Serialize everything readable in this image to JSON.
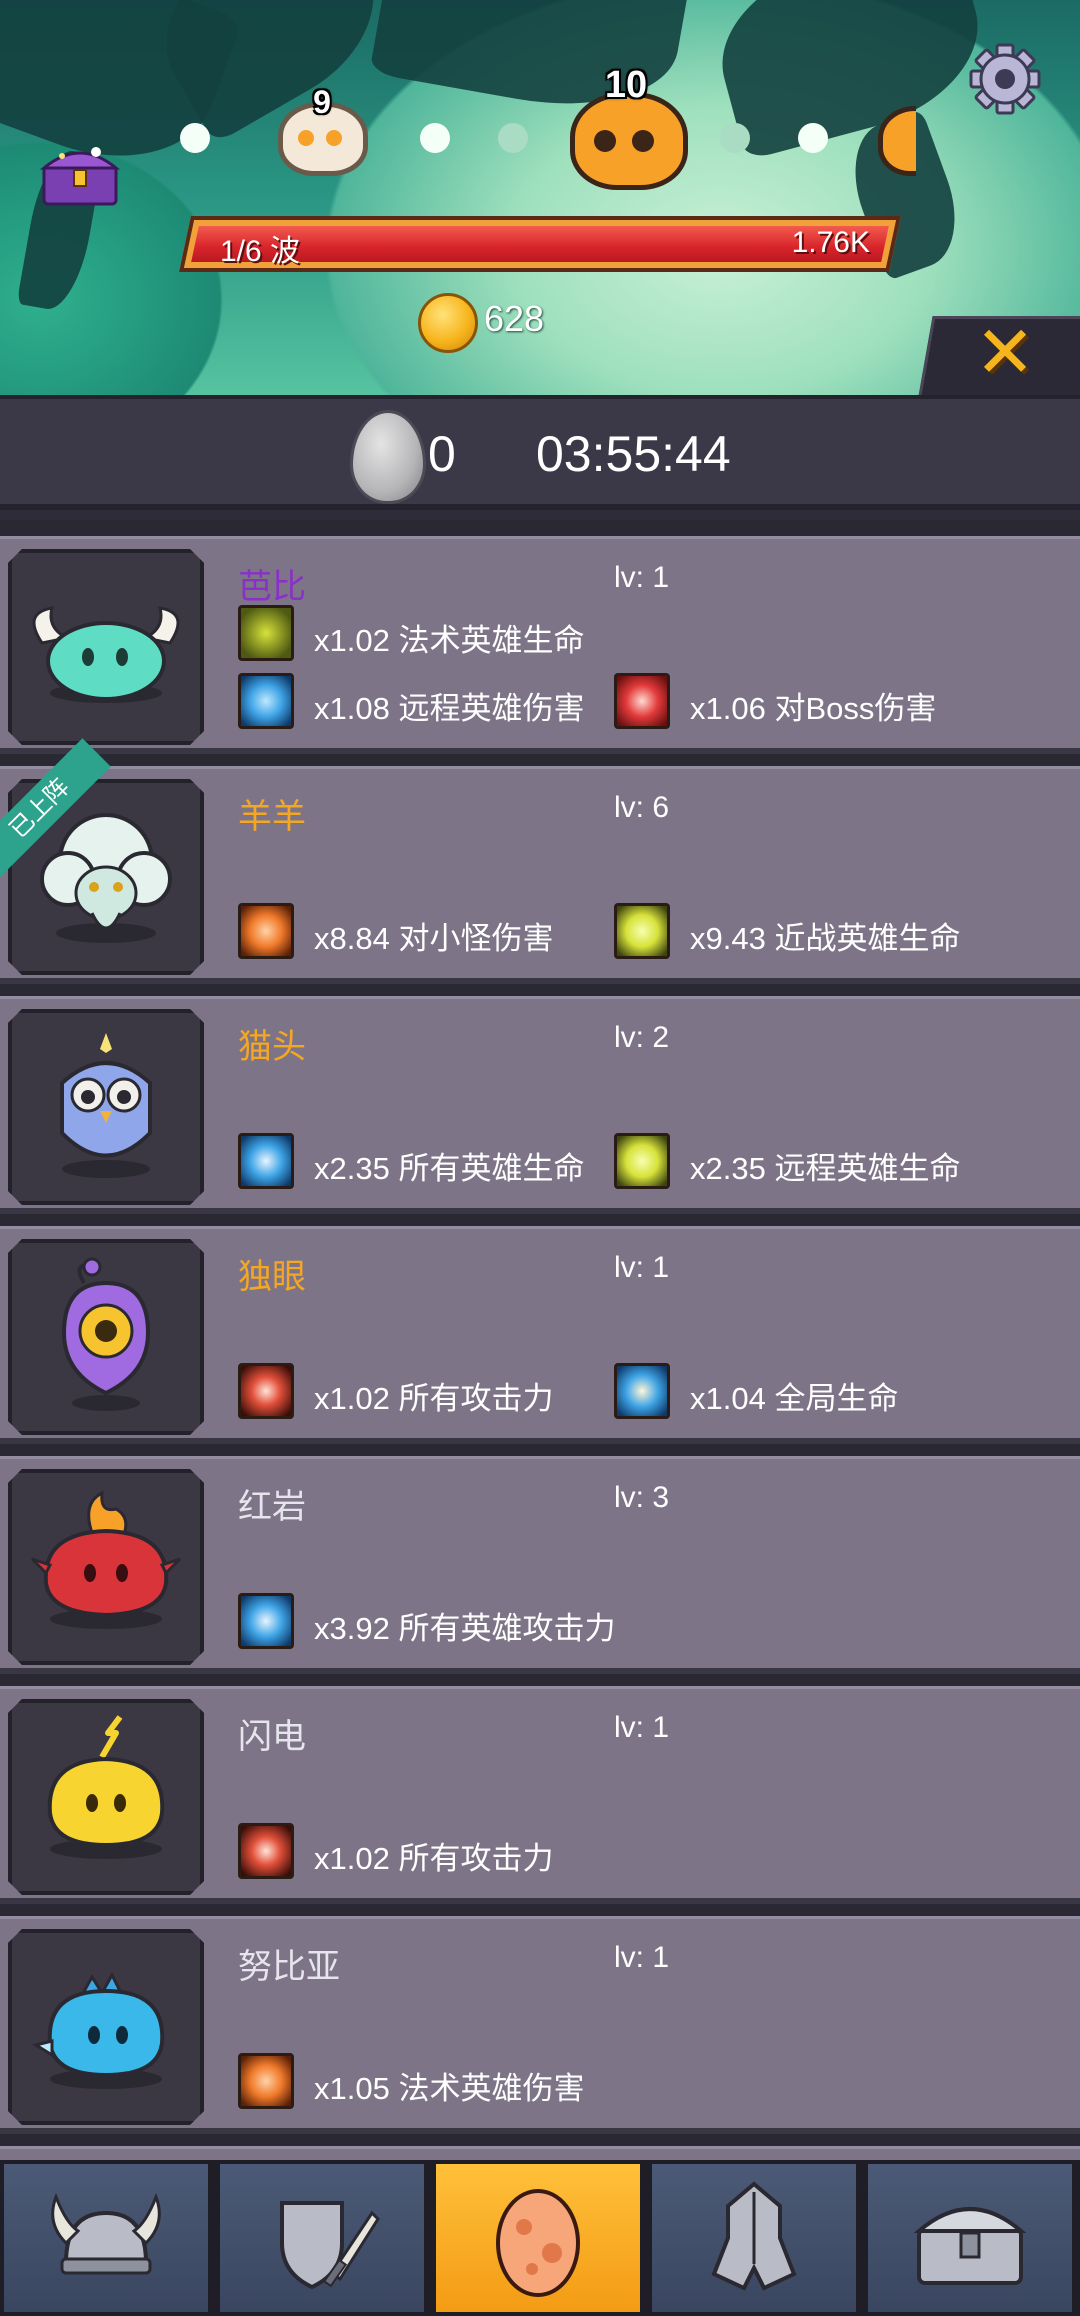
{
  "stages": {
    "left": "9",
    "current": "10"
  },
  "wave": {
    "label": "1/6 波",
    "hp": "1.76K"
  },
  "coins": "628",
  "eggs": {
    "count": "0",
    "timer": "03:55:44"
  },
  "deployed_tag": "已上阵",
  "pets": [
    {
      "name": "芭比",
      "name_color": "#8b2fc9",
      "level": "lv: 1",
      "buffs": [
        {
          "text": "x1.02 法术英雄生命",
          "icon": "magic-hero-health-icon",
          "color": "#d7e23a"
        },
        {
          "text": "x1.08 远程英雄伤害",
          "icon": "ranged-hero-damage-icon",
          "color": "#3fa4e6"
        },
        {
          "text": "x1.06 对Boss伤害",
          "icon": "boss-damage-icon",
          "color": "#e23a3a"
        }
      ]
    },
    {
      "name": "羊羊",
      "name_color": "#f5a623",
      "level": "lv: 6",
      "buffs": [
        {
          "text": "x8.84 对小怪伤害",
          "icon": "minion-damage-icon",
          "color": "#f07a2a"
        },
        {
          "text": "x9.43 近战英雄生命",
          "icon": "melee-hero-health-icon",
          "color": "#d7e23a"
        }
      ]
    },
    {
      "name": "猫头",
      "name_color": "#f5a623",
      "level": "lv: 2",
      "buffs": [
        {
          "text": "x2.35 所有英雄生命",
          "icon": "all-heroes-health-icon",
          "color": "#3fa4e6"
        },
        {
          "text": "x2.35 远程英雄生命",
          "icon": "ranged-hero-health-icon",
          "color": "#d7e23a"
        }
      ]
    },
    {
      "name": "独眼",
      "name_color": "#f5a623",
      "level": "lv: 1",
      "buffs": [
        {
          "text": "x1.02 所有攻击力",
          "icon": "all-attack-icon",
          "color": "#e23a3a"
        },
        {
          "text": "x1.04 全局生命",
          "icon": "global-health-icon",
          "color": "#3fa4e6"
        }
      ]
    },
    {
      "name": "红岩",
      "name_color": "#e6e4ec",
      "level": "lv: 3",
      "buffs": [
        {
          "text": "x3.92 所有英雄攻击力",
          "icon": "all-heroes-attack-icon",
          "color": "#3fa4e6"
        }
      ]
    },
    {
      "name": "闪电",
      "name_color": "#e6e4ec",
      "level": "lv: 1",
      "buffs": [
        {
          "text": "x1.02 所有攻击力",
          "icon": "all-attack-icon",
          "color": "#e23a3a"
        }
      ]
    },
    {
      "name": "努比亚",
      "name_color": "#e6e4ec",
      "level": "lv: 1",
      "buffs": [
        {
          "text": "x1.05 法术英雄伤害",
          "icon": "magic-hero-damage-icon",
          "color": "#f07a2a"
        }
      ]
    }
  ]
}
